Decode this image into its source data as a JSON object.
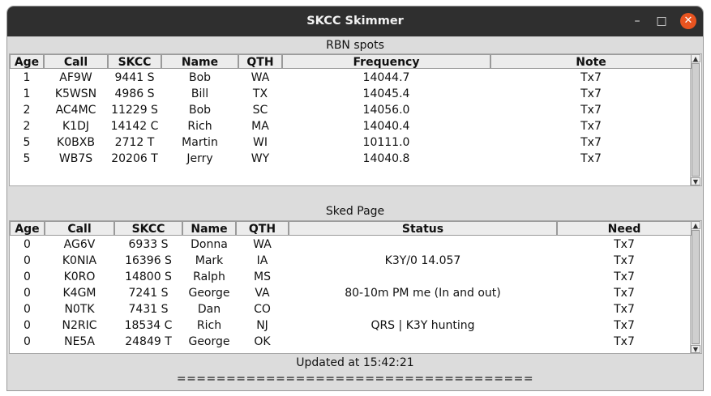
{
  "window": {
    "title": "SKCC Skimmer",
    "minimize": "–",
    "maximize": "□",
    "close": "✕"
  },
  "rbn": {
    "label": "RBN spots",
    "headers": [
      "Age",
      "Call",
      "SKCC",
      "Name",
      "QTH",
      "Frequency",
      "Note"
    ],
    "rows": [
      [
        "1",
        "AF9W",
        "9441 S",
        "Bob",
        "WA",
        "14044.7",
        "Tx7"
      ],
      [
        "1",
        "K5WSN",
        "4986 S",
        "Bill",
        "TX",
        "14045.4",
        "Tx7"
      ],
      [
        "2",
        "AC4MC",
        "11229 S",
        "Bob",
        "SC",
        "14056.0",
        "Tx7"
      ],
      [
        "2",
        "K1DJ",
        "14142 C",
        "Rich",
        "MA",
        "14040.4",
        "Tx7"
      ],
      [
        "5",
        "K0BXB",
        "2712 T",
        "Martin",
        "WI",
        "10111.0",
        "Tx7"
      ],
      [
        "5",
        "WB7S",
        "20206 T",
        "Jerry",
        "WY",
        "14040.8",
        "Tx7"
      ]
    ]
  },
  "sked": {
    "label": "Sked Page",
    "headers": [
      "Age",
      "Call",
      "SKCC",
      "Name",
      "QTH",
      "Status",
      "Need"
    ],
    "rows": [
      [
        "0",
        "AG6V",
        "6933 S",
        "Donna",
        "WA",
        "",
        "Tx7"
      ],
      [
        "0",
        "K0NIA",
        "16396 S",
        "Mark",
        "IA",
        "K3Y/0 14.057",
        "Tx7"
      ],
      [
        "0",
        "K0RO",
        "14800 S",
        "Ralph",
        "MS",
        "",
        "Tx7"
      ],
      [
        "0",
        "K4GM",
        "7241 S",
        "George",
        "VA",
        "80-10m PM me (In and out)",
        "Tx7"
      ],
      [
        "0",
        "N0TK",
        "7431 S",
        "Dan",
        "CO",
        "",
        "Tx7"
      ],
      [
        "0",
        "N2RIC",
        "18534 C",
        "Rich",
        "NJ",
        "QRS | K3Y hunting",
        "Tx7"
      ],
      [
        "0",
        "NE5A",
        "24849 T",
        "George",
        "OK",
        "",
        "Tx7"
      ]
    ]
  },
  "footer": {
    "updated": "Updated at 15:42:21",
    "separator": "===================================="
  }
}
